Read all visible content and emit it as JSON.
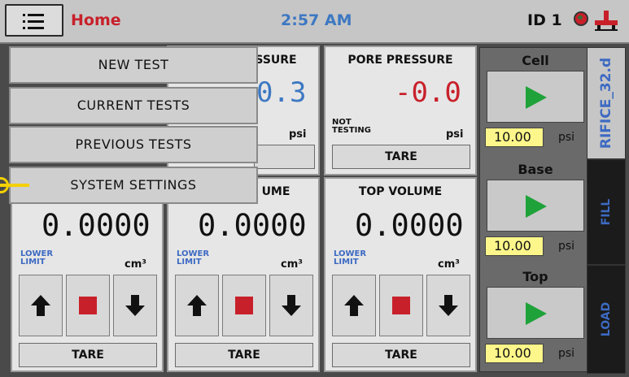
{
  "header": {
    "home_label": "Home",
    "clock": "2:57 AM",
    "id_label": "ID 1"
  },
  "panels": {
    "cell_pressure": {
      "title_partial": "SSURE",
      "value_partial": "0.3",
      "unit": "psi"
    },
    "pore_pressure": {
      "title": "PORE PRESSURE",
      "value": "-0.0",
      "status": "NOT TESTING",
      "unit": "psi",
      "tare": "TARE"
    },
    "base_volume": {
      "value": "0.0000",
      "limit": "LOWER LIMIT",
      "unit": "cm³",
      "tare": "TARE"
    },
    "cell_volume": {
      "title_partial": "UME",
      "value": "0.0000",
      "limit": "LOWER LIMIT",
      "unit": "cm³",
      "tare": "TARE"
    },
    "top_volume": {
      "title": "TOP VOLUME",
      "value": "0.0000",
      "limit": "LOWER LIMIT",
      "unit": "cm³",
      "tare": "TARE"
    }
  },
  "pump_panel": {
    "cell": {
      "title": "Cell",
      "value": "10.00",
      "unit": "psi"
    },
    "base": {
      "title": "Base",
      "value": "10.00",
      "unit": "psi"
    },
    "top": {
      "title": "Top",
      "value": "10.00",
      "unit": "psi"
    }
  },
  "tabs": {
    "orifice": "RIFICE_32.d",
    "fill": "FILL",
    "load": "LOAD"
  },
  "menu": {
    "items": [
      "NEW TEST",
      "CURRENT TESTS",
      "PREVIOUS TESTS",
      "SYSTEM SETTINGS"
    ]
  },
  "colors": {
    "accent_red": "#c8202a",
    "accent_blue": "#3d78c2",
    "play_green": "#1fa23a",
    "psi_yellow": "#fdf68a",
    "pointer_yellow": "#f4d000"
  }
}
